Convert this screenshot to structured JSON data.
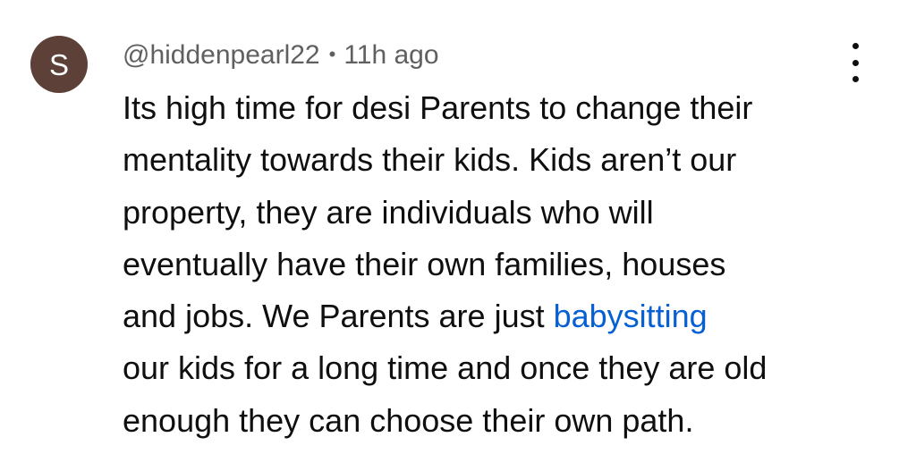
{
  "comment": {
    "avatar_letter": "S",
    "avatar_color": "#5d4037",
    "author": "@hiddenpearl22",
    "separator": "•",
    "time": "11h ago",
    "menu_icon": "more-vertical-icon",
    "text_lines": [
      "Its high time for desi Parents to change their",
      "mentality towards their kids. Kids aren’t our",
      "property, they are individuals who will",
      "eventually have their own families, houses",
      "and jobs. We Parents are just ",
      "our kids for a long time and once they are old",
      "enough they can choose their own path."
    ],
    "link_text": "babysitting",
    "link_color": "#065fd4"
  }
}
